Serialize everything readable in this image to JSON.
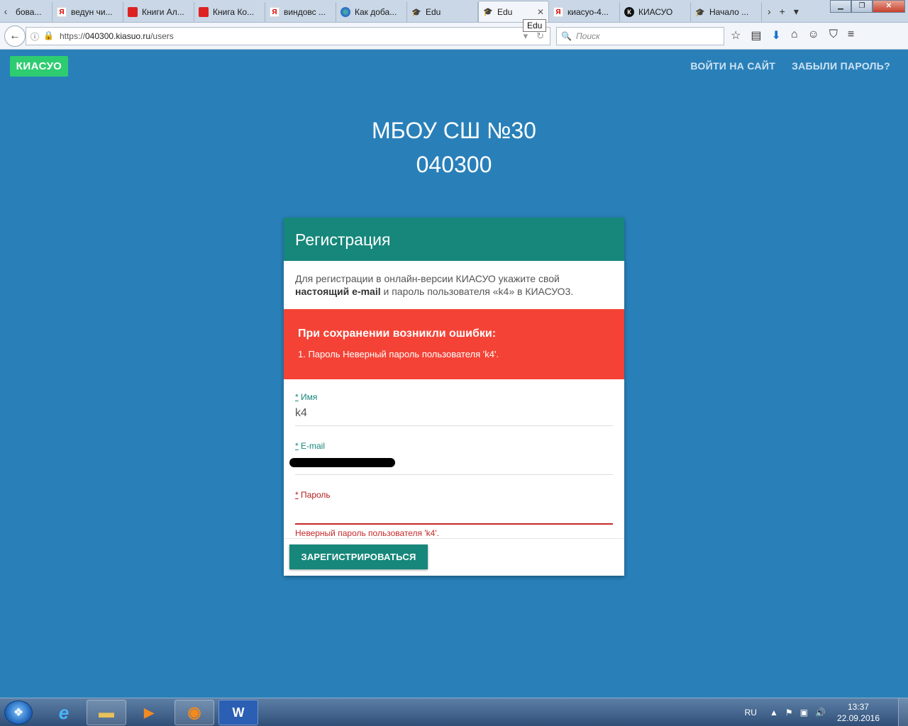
{
  "browser": {
    "tabs": [
      {
        "label": "бова...",
        "icon": "yandex-icon"
      },
      {
        "label": "ведун чи...",
        "icon": "yandex-icon"
      },
      {
        "label": "Книги Ал...",
        "icon": "book-icon"
      },
      {
        "label": "Книга Ко...",
        "icon": "book-icon"
      },
      {
        "label": "виндовс ...",
        "icon": "yandex-icon"
      },
      {
        "label": "Как доба...",
        "icon": "ie-icon"
      },
      {
        "label": "Edu",
        "icon": "cap-icon"
      },
      {
        "label": "Edu",
        "icon": "cap-icon",
        "active": true
      },
      {
        "label": "киасуо-4...",
        "icon": "yandex-icon"
      },
      {
        "label": "КИАСУО",
        "icon": "kiasuo-icon"
      },
      {
        "label": "Начало ...",
        "icon": "cap-icon"
      }
    ],
    "tab_glyphs": {
      "left": "‹",
      "right": "›",
      "new": "+",
      "list": "▾",
      "close": "✕"
    },
    "tab_icon_glyphs": {
      "ya": "Я",
      "cap": "🎓",
      "kiasuo": "К"
    },
    "window_glyphs": {
      "min": "▁",
      "max": "❐",
      "close": "✕"
    },
    "tooltip": "Edu",
    "url": {
      "prefix": "https://",
      "host": "040300.kiasuo.ru",
      "path": "/users"
    },
    "search_placeholder": "Поиск",
    "nav_glyphs": {
      "back": "←",
      "search": "🔍",
      "bookmark": "☆",
      "reader": "▤",
      "download": "⬇",
      "home": "⌂",
      "chat": "☺",
      "pocket": "⛉",
      "menu": "≡",
      "info": "ⓘ",
      "lock": "🔒",
      "dropdown": "▾",
      "reload": "↻"
    }
  },
  "page": {
    "brand": "КИАСУО",
    "nav": {
      "login": "ВОЙТИ НА САЙТ",
      "forgot": "ЗАБЫЛИ ПАРОЛЬ?"
    },
    "school_name": "МБОУ СШ №30",
    "school_code": "040300",
    "card": {
      "title": "Регистрация",
      "intro_part1": "Для регистрации в онлайн-версии КИАСУО укажите свой",
      "intro_bold": "настоящий e-mail",
      "intro_part2": "и пароль пользователя «k4» в КИАСУО3.",
      "error_title": "При сохранении возникли ошибки:",
      "error_item": "1. Пароль Неверный пароль пользователя 'k4'.",
      "fields": {
        "name": {
          "req": "*",
          "label": "Имя",
          "value": "k4"
        },
        "email": {
          "req": "*",
          "label": "E-mail",
          "value": ""
        },
        "password": {
          "req": "*",
          "label": "Пароль",
          "value": "",
          "error": "Неверный пароль пользователя 'k4'."
        }
      },
      "submit": "ЗАРЕГИСТРИРОВАТЬСЯ"
    },
    "colors": {
      "background": "#2980b9",
      "brand": "#2ecc71",
      "card_header": "#16877a",
      "error": "#f44336"
    }
  },
  "taskbar": {
    "apps": [
      "Internet Explorer",
      "Проводник",
      "Windows Media Player",
      "Firefox",
      "Word"
    ],
    "app_glyphs": {
      "start": "❖",
      "ie": "e",
      "folder": "▬",
      "media": "▶",
      "firefox": "◉",
      "word": "W"
    },
    "tray_glyphs": {
      "show_hidden": "▲",
      "flag": "⚑",
      "network": "▣",
      "volume": "🔊"
    },
    "language": "RU",
    "time": "13:37",
    "date": "22.09.2016"
  }
}
